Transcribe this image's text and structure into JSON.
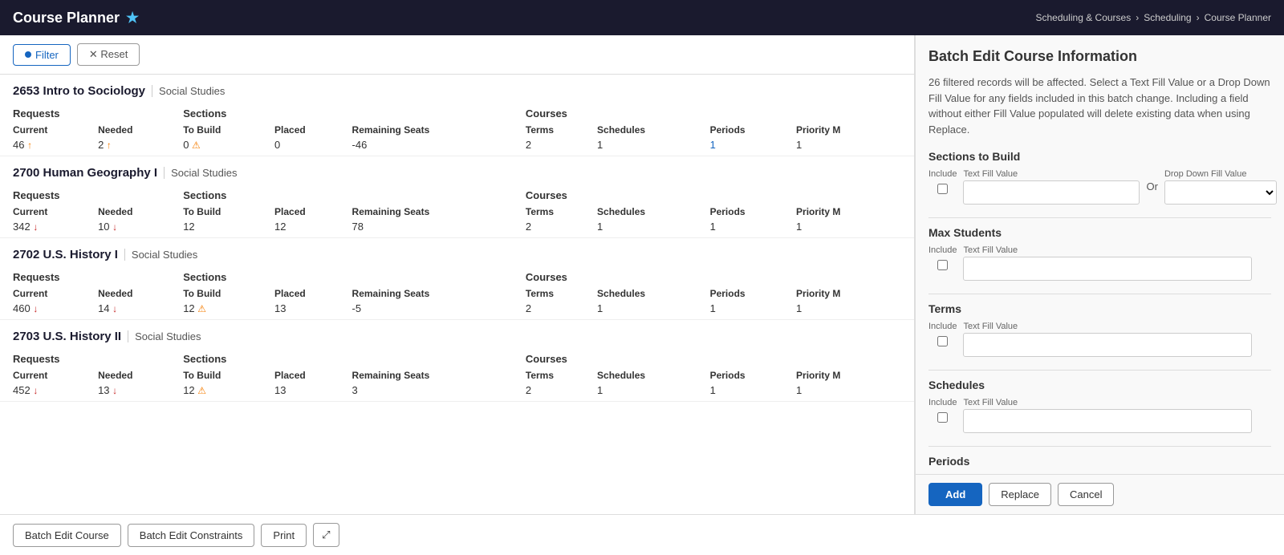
{
  "header": {
    "title": "Course Planner",
    "star": "★",
    "breadcrumb": [
      "Scheduling & Courses",
      "Scheduling",
      "Course Planner"
    ]
  },
  "toolbar": {
    "filter_label": "Filter",
    "reset_label": "✕ Reset"
  },
  "courses": [
    {
      "id": "2653",
      "name": "Intro to Sociology",
      "category": "Social Studies",
      "requests": {
        "current": "46",
        "current_arrow": "↑",
        "current_arrow_class": "arrow-up",
        "needed": "2",
        "needed_arrow": "↑",
        "needed_arrow_class": "arrow-up"
      },
      "sections": {
        "to_build": "0",
        "to_build_warn": true,
        "placed": "0",
        "remaining_seats": "-46"
      },
      "courses": {
        "terms": "2",
        "schedules": "1",
        "periods": "1",
        "priority_m": "1"
      }
    },
    {
      "id": "2700",
      "name": "Human Geography I",
      "category": "Social Studies",
      "requests": {
        "current": "342",
        "current_arrow": "↓",
        "current_arrow_class": "arrow-down",
        "needed": "10",
        "needed_arrow": "↓",
        "needed_arrow_class": "arrow-down"
      },
      "sections": {
        "to_build": "12",
        "to_build_warn": false,
        "placed": "12",
        "remaining_seats": "78"
      },
      "courses": {
        "terms": "2",
        "schedules": "1",
        "periods": "1",
        "priority_m": "1"
      }
    },
    {
      "id": "2702",
      "name": "U.S. History I",
      "category": "Social Studies",
      "requests": {
        "current": "460",
        "current_arrow": "↓",
        "current_arrow_class": "arrow-down",
        "needed": "14",
        "needed_arrow": "↓",
        "needed_arrow_class": "arrow-down"
      },
      "sections": {
        "to_build": "12",
        "to_build_warn": true,
        "placed": "13",
        "remaining_seats": "-5"
      },
      "courses": {
        "terms": "2",
        "schedules": "1",
        "periods": "1",
        "priority_m": "1"
      }
    },
    {
      "id": "2703",
      "name": "U.S. History II",
      "category": "Social Studies",
      "requests": {
        "current": "452",
        "current_arrow": "↓",
        "current_arrow_class": "arrow-down",
        "needed": "13",
        "needed_arrow": "↓",
        "needed_arrow_class": "arrow-down"
      },
      "sections": {
        "to_build": "12",
        "to_build_warn": true,
        "placed": "13",
        "remaining_seats": "3"
      },
      "courses": {
        "terms": "2",
        "schedules": "1",
        "periods": "1",
        "priority_m": "1"
      }
    }
  ],
  "right_panel": {
    "title": "Batch Edit Course Information",
    "description": "26 filtered records will be affected. Select a Text Fill Value or a Drop Down Fill Value for any fields included in this batch change. Including a field without either Fill Value populated will delete existing data when using Replace.",
    "sections": [
      {
        "name": "Sections to Build",
        "has_dropdown": true
      },
      {
        "name": "Max Students",
        "has_dropdown": false
      },
      {
        "name": "Terms",
        "has_dropdown": false
      },
      {
        "name": "Schedules",
        "has_dropdown": false
      },
      {
        "name": "Periods",
        "has_dropdown": false
      }
    ],
    "labels": {
      "include": "Include",
      "text_fill_value": "Text Fill Value",
      "drop_down_fill_value": "Drop Down Fill Value",
      "or": "Or"
    },
    "buttons": {
      "add": "Add",
      "replace": "Replace",
      "cancel": "Cancel"
    }
  },
  "bottom_toolbar": {
    "batch_edit_course": "Batch Edit Course",
    "batch_edit_constraints": "Batch Edit Constraints",
    "print": "Print",
    "expand": "⤢"
  },
  "column_headers": {
    "requests": "Requests",
    "sections": "Sections",
    "courses": "Courses",
    "current": "Current",
    "needed": "Needed",
    "to_build": "To Build",
    "placed": "Placed",
    "remaining_seats": "Remaining Seats",
    "terms": "Terms",
    "schedules": "Schedules",
    "periods": "Periods",
    "priority_m": "Priority M"
  }
}
